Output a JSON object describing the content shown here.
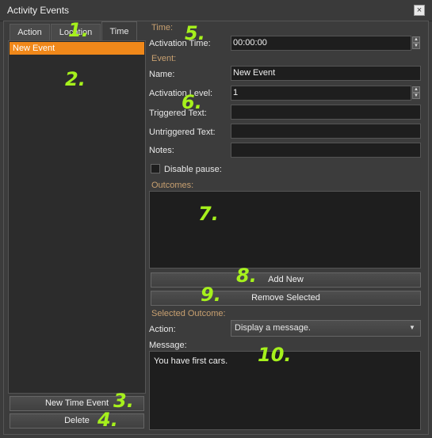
{
  "window": {
    "title": "Activity Events",
    "close": "×"
  },
  "tabs": [
    {
      "label": "Action"
    },
    {
      "label": "Location"
    },
    {
      "label": "Time",
      "active": true
    }
  ],
  "event_list": {
    "items": [
      "New Event"
    ]
  },
  "left_buttons": {
    "new_time_event": "New Time Event",
    "delete": "Delete"
  },
  "time_section": {
    "header": "Time:",
    "activation_time_label": "Activation Time:",
    "activation_time_value": "00:00:00"
  },
  "event_section": {
    "header": "Event:",
    "name_label": "Name:",
    "name_value": "New Event",
    "activation_level_label": "Activation Level:",
    "activation_level_value": "1",
    "triggered_label": "Triggered Text:",
    "triggered_value": "",
    "untriggered_label": "Untriggered Text:",
    "untriggered_value": "",
    "notes_label": "Notes:",
    "notes_value": "",
    "disable_pause_label": "Disable pause:"
  },
  "outcomes": {
    "header": "Outcomes:",
    "add_new": "Add New",
    "remove_selected": "Remove Selected"
  },
  "selected_outcome": {
    "header": "Selected Outcome:",
    "action_label": "Action:",
    "action_value": "Display a message.",
    "message_label": "Message:",
    "message_value": "You have first cars."
  },
  "annotations": [
    "1.",
    "2.",
    "3.",
    "4.",
    "5.",
    "6.",
    "7.",
    "8.",
    "9.",
    "10."
  ],
  "colors": {
    "accent": "#f0881a",
    "annotation": "#a6f11c",
    "section_label": "#c8a070"
  },
  "icons": {
    "spin_up": "▲",
    "spin_down": "▼",
    "dropdown": "▼"
  }
}
